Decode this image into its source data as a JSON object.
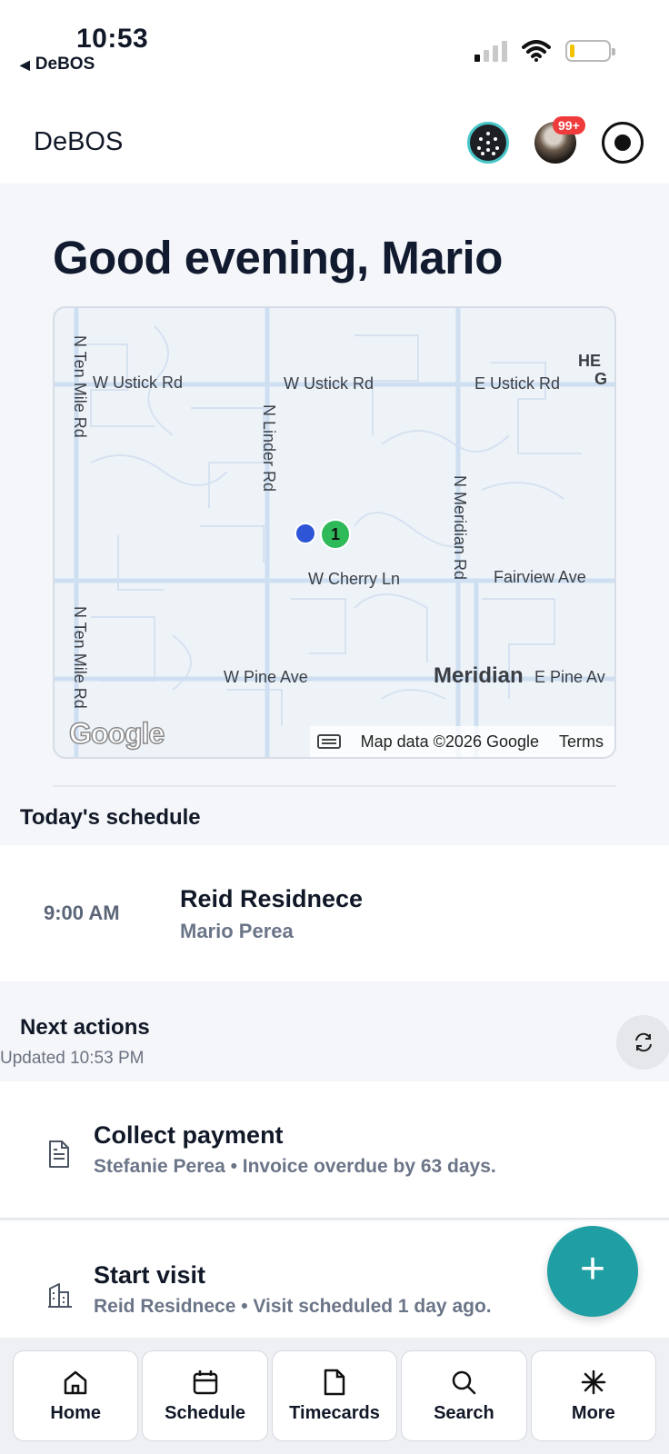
{
  "status_bar": {
    "time": "10:53",
    "back_app": "DeBOS"
  },
  "header": {
    "brand": "DeBOS",
    "notification_badge": "99+"
  },
  "greeting": "Good evening, Mario",
  "map": {
    "labels": {
      "w_ustick_1": "W Ustick Rd",
      "w_ustick_2": "W Ustick Rd",
      "e_ustick": "E Ustick Rd",
      "he": "HE",
      "g": "G",
      "n_ten_mile_1": "N Ten Mile Rd",
      "n_ten_mile_2": "N Ten Mile Rd",
      "n_linder": "N Linder Rd",
      "n_meridian": "N Meridian Rd",
      "w_cherry": "W Cherry Ln",
      "fairview": "Fairview Ave",
      "w_pine": "W Pine Ave",
      "meridian": "Meridian",
      "e_pine": "E Pine Av"
    },
    "pin_number": "1",
    "logo": "Google",
    "attribution": "Map data ©2026 Google",
    "terms": "Terms"
  },
  "schedule": {
    "title": "Today's schedule",
    "items": [
      {
        "time": "9:00 AM",
        "title": "Reid Residnece",
        "subtitle": "Mario Perea"
      }
    ]
  },
  "next_actions": {
    "title": "Next actions",
    "updated": "Updated 10:53 PM",
    "items": [
      {
        "title": "Collect payment",
        "subtitle": "Stefanie Perea • Invoice overdue by 63 days.",
        "icon": "document-icon"
      },
      {
        "title": "Start visit",
        "subtitle": "Reid Residnece • Visit scheduled 1 day ago.",
        "icon": "building-icon"
      }
    ]
  },
  "fab_label": "+",
  "nav": {
    "items": [
      {
        "label": "Home",
        "icon": "home-icon"
      },
      {
        "label": "Schedule",
        "icon": "calendar-icon"
      },
      {
        "label": "Timecards",
        "icon": "file-icon"
      },
      {
        "label": "Search",
        "icon": "search-icon"
      },
      {
        "label": "More",
        "icon": "sparkle-icon"
      }
    ]
  },
  "colors": {
    "accent": "#1f9ea3",
    "badge": "#ef3b3b",
    "pin_green": "#2fba5a",
    "pin_blue": "#2d55d6"
  }
}
